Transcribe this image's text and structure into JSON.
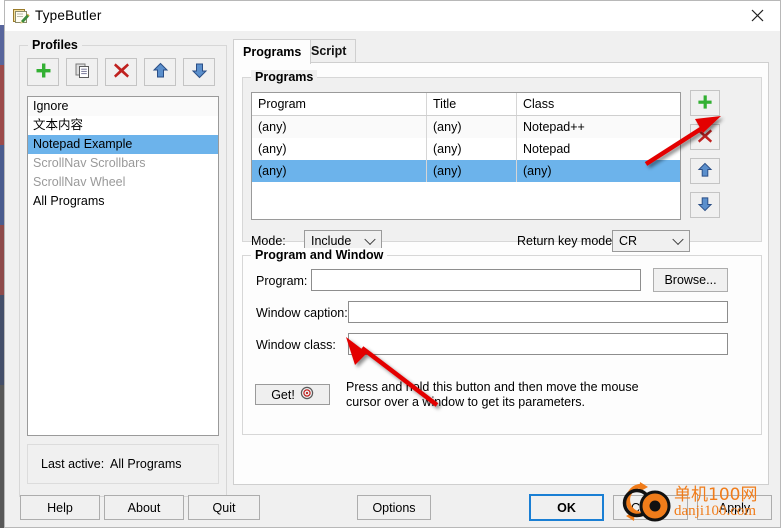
{
  "window": {
    "title": "TypeButler",
    "icon": "document-pencil-icon",
    "close_label": "Close"
  },
  "profiles": {
    "legend": "Profiles",
    "toolbar": [
      {
        "name": "add-profile-button",
        "icon": "plus-icon"
      },
      {
        "name": "copy-profile-button",
        "icon": "copy-icon"
      },
      {
        "name": "delete-profile-button",
        "icon": "red-x-icon"
      },
      {
        "name": "move-profile-up-button",
        "icon": "arrow-up-icon"
      },
      {
        "name": "move-profile-down-button",
        "icon": "arrow-down-icon"
      }
    ],
    "items": [
      {
        "label": "Ignore",
        "selected": false,
        "disabled": false
      },
      {
        "label": "文本内容",
        "selected": false,
        "disabled": false
      },
      {
        "label": "Notepad Example",
        "selected": true,
        "disabled": false
      },
      {
        "label": "ScrollNav Scrollbars",
        "selected": false,
        "disabled": true
      },
      {
        "label": "ScrollNav Wheel",
        "selected": false,
        "disabled": true
      },
      {
        "label": "All Programs",
        "selected": false,
        "disabled": false
      }
    ],
    "last_active_label": "Last active:",
    "last_active_value": "All Programs"
  },
  "tabs": [
    {
      "label": "Programs",
      "active": true
    },
    {
      "label": "Script",
      "active": false
    }
  ],
  "programs": {
    "legend": "Programs",
    "columns": [
      "Program",
      "Title",
      "Class"
    ],
    "rows": [
      {
        "program": "(any)",
        "title": "(any)",
        "class": "Notepad++",
        "selected": false
      },
      {
        "program": "(any)",
        "title": "(any)",
        "class": "Notepad",
        "selected": false
      },
      {
        "program": "(any)",
        "title": "(any)",
        "class": "(any)",
        "selected": true
      }
    ],
    "side_buttons": [
      {
        "name": "add-program-button",
        "icon": "plus-icon"
      },
      {
        "name": "delete-program-button",
        "icon": "red-x-icon"
      },
      {
        "name": "move-program-up-button",
        "icon": "arrow-up-icon"
      },
      {
        "name": "move-program-down-button",
        "icon": "arrow-down-icon"
      }
    ],
    "mode_label": "Mode:",
    "mode_value": "Include",
    "return_key_mode_label": "Return key mode:",
    "return_key_mode_value": "CR"
  },
  "program_and_window": {
    "legend": "Program and Window",
    "program_label": "Program:",
    "program_value": "",
    "browse_label": "Browse...",
    "window_caption_label": "Window caption:",
    "window_caption_value": "",
    "window_class_label": "Window class:",
    "window_class_value": "",
    "get_label": "Get!",
    "get_icon": "target-crosshair-icon",
    "get_hint": "Press and hold this button and then move the mouse cursor over a window to get its parameters."
  },
  "bottom_bar": {
    "help": "Help",
    "about": "About",
    "quit": "Quit",
    "options": "Options",
    "ok": "OK",
    "cancel": "Cancel",
    "apply": "Apply"
  },
  "watermark": {
    "line1": "单机100网",
    "line2": "danji100.com",
    "color": "#f07c1a"
  },
  "colors": {
    "selection": "#6cb3eb",
    "accent": "#1a7fd4",
    "annotation_arrow": "#e30000"
  }
}
